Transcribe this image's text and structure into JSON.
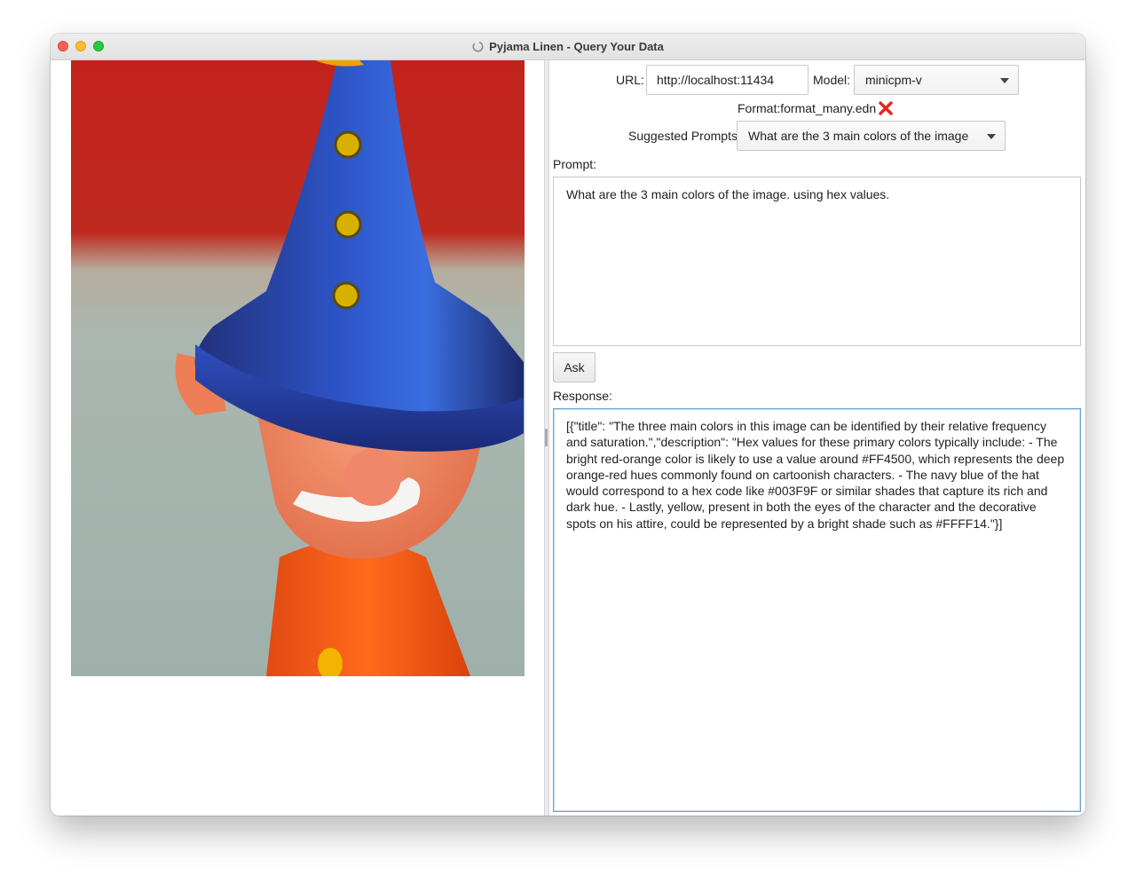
{
  "window": {
    "title": "Pyjama Linen - Query Your Data"
  },
  "image": {
    "icon": "figurine-photo"
  },
  "form": {
    "url_label": "URL:",
    "url_value": "http://localhost:11434",
    "model_label": "Model:",
    "model_value": "minicpm-v",
    "format_text": "Format:format_many.edn",
    "format_status_icon": "red-x-icon",
    "suggested_label": "Suggested Prompts:",
    "suggested_value": "What are the 3 main colors of the image",
    "prompt_label": "Prompt:",
    "prompt_value": "What are the 3 main colors of the image. using hex values.",
    "ask_label": "Ask",
    "response_label": "Response:",
    "response_value": "[{\"title\": \"The three main colors in this image can be identified by their relative frequency and saturation.\",\"description\": \"Hex values for these primary colors typically include: - The bright red-orange color is likely to use a value around #FF4500, which represents the deep orange-red hues commonly found on cartoonish characters. - The navy blue of the hat would correspond to a hex code like #003F9F or similar shades that capture its rich and dark hue. - Lastly, yellow, present in both the eyes of the character and the decorative spots on his attire, could be represented by a bright shade such as #FFFF14.\"}]"
  },
  "colors": {
    "close": "#fe5f57",
    "minimize": "#febc2e",
    "maximize": "#28c840",
    "focus_border": "#6d9fd4",
    "error_x": "#e8231a"
  }
}
